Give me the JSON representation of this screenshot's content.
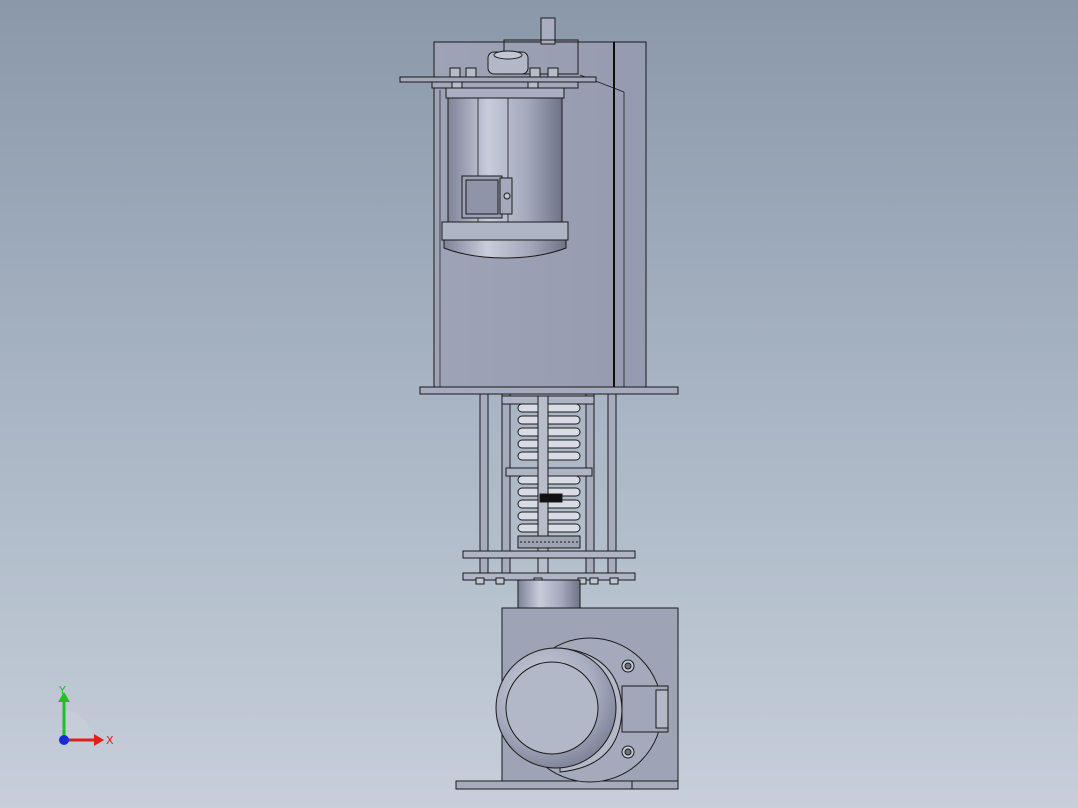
{
  "viewport": {
    "colors": {
      "background_top": "#8a98aa",
      "background_bottom": "#c6cfda",
      "part_fill": "#9aa0b3",
      "edge": "#1a1a1a"
    }
  },
  "triad": {
    "x_label": "X",
    "y_label": "Y",
    "colors": {
      "x_axis": "#e0201a",
      "y_axis": "#1fbf2a",
      "z_axis": "#1a2ad8"
    }
  }
}
